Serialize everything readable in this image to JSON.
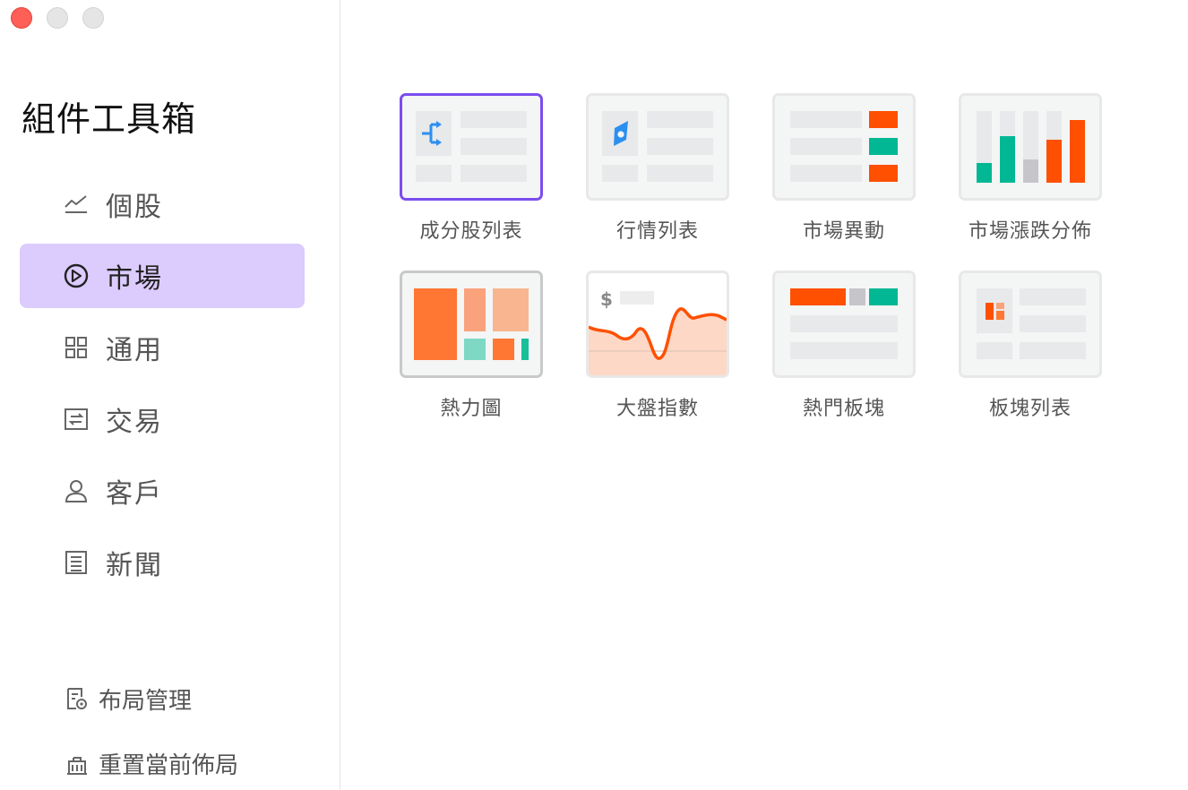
{
  "window": {
    "controls": [
      "close",
      "minimize",
      "maximize"
    ]
  },
  "sidebar": {
    "title": "組件工具箱",
    "items": [
      {
        "label": "個股",
        "icon": "line-chart-icon",
        "active": false
      },
      {
        "label": "市場",
        "icon": "compass-icon",
        "active": true
      },
      {
        "label": "通用",
        "icon": "grid-icon",
        "active": false
      },
      {
        "label": "交易",
        "icon": "exchange-icon",
        "active": false
      },
      {
        "label": "客戶",
        "icon": "user-icon",
        "active": false
      },
      {
        "label": "新聞",
        "icon": "news-icon",
        "active": false
      }
    ],
    "bottom": [
      {
        "label": "布局管理",
        "icon": "layout-settings-icon"
      },
      {
        "label": "重置當前佈局",
        "icon": "reset-layout-icon"
      }
    ]
  },
  "widgets": [
    {
      "label": "成分股列表",
      "selected": true
    },
    {
      "label": "行情列表",
      "selected": false
    },
    {
      "label": "市場異動",
      "selected": false
    },
    {
      "label": "市場漲跌分佈",
      "selected": false
    },
    {
      "label": "熱力圖",
      "selected": false,
      "hover": true
    },
    {
      "label": "大盤指數",
      "selected": false
    },
    {
      "label": "熱門板塊",
      "selected": false
    },
    {
      "label": "板塊列表",
      "selected": false
    }
  ],
  "thumbnail_text": {
    "dollar": "$"
  },
  "colors": {
    "accent": "#7b4dee",
    "active_bg": "#dccbfd",
    "orange": "#fe5000",
    "teal": "#02b894",
    "blue": "#2b8ff0",
    "light_orange": "#ff7733"
  }
}
